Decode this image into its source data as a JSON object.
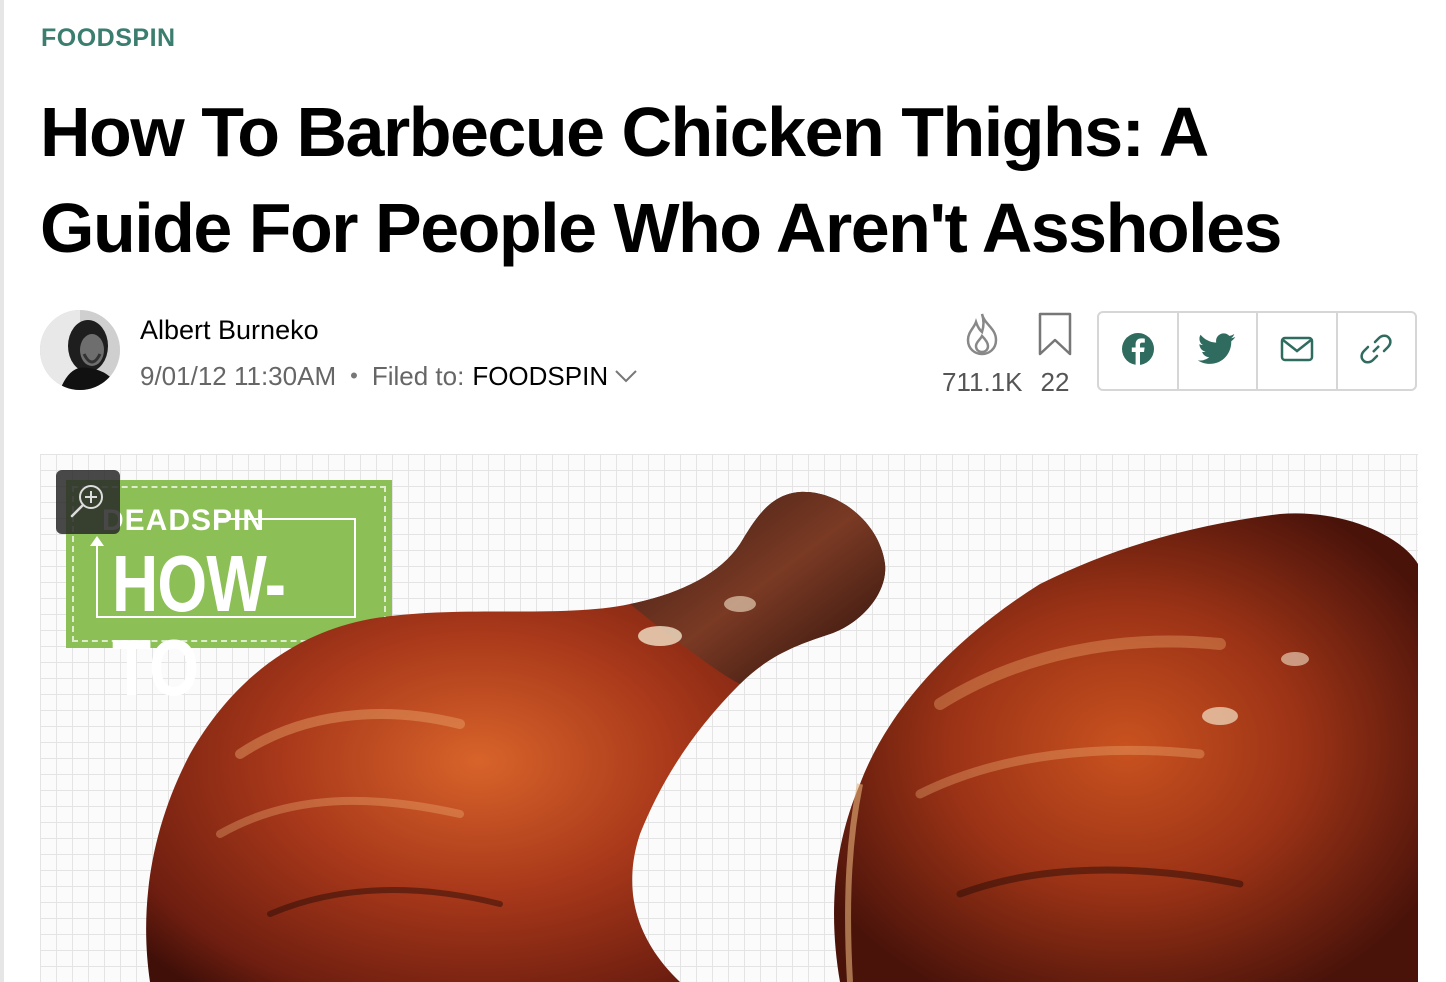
{
  "article": {
    "category": "FOODSPIN",
    "headline": "How To Barbecue Chicken Thighs: A Guide For People Who Aren't Assholes",
    "author": "Albert Burneko",
    "timestamp": "9/01/12 11:30AM",
    "separator": "•",
    "filed_label": "Filed to:",
    "filed_category": "FOODSPIN"
  },
  "stats": {
    "views_icon": "flame-icon",
    "views": "711.1K",
    "bookmarks_icon": "bookmark-icon",
    "bookmarks": "22"
  },
  "share": [
    {
      "name": "facebook-icon"
    },
    {
      "name": "twitter-icon"
    },
    {
      "name": "email-icon"
    },
    {
      "name": "link-icon"
    }
  ],
  "hero": {
    "badge_brand": "DEADSPIN",
    "badge_title": "HOW-TO",
    "zoom_icon": "zoom-in-icon"
  },
  "colors": {
    "category": "#3b7d6e",
    "share_icons": "#2f6b5e",
    "badge": "#8cbf55"
  }
}
